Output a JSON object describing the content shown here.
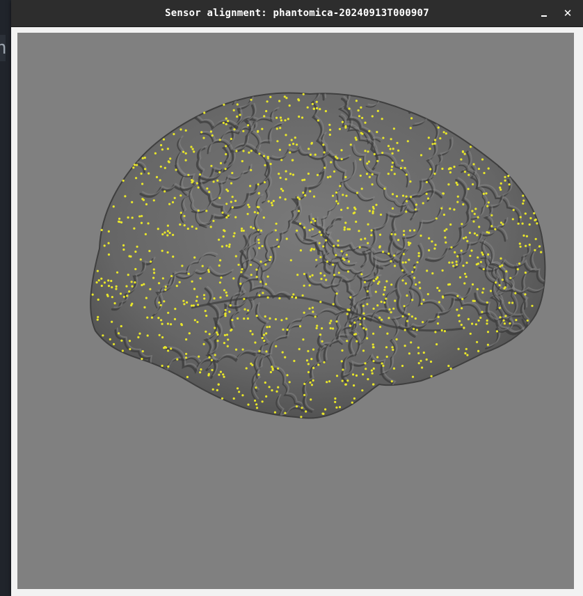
{
  "window": {
    "title": "Sensor alignment: phantomica-20240913T000907",
    "minimize_glyph": "–",
    "close_glyph": "✕"
  },
  "background": {
    "partial_text": "h"
  },
  "scene": {
    "description_icon": "brain-surface-render",
    "background_color": "#808080",
    "surface_color": "#6b6b6b",
    "sensor_color": "#e8e62a",
    "sensor_icon": "sensor-point"
  }
}
